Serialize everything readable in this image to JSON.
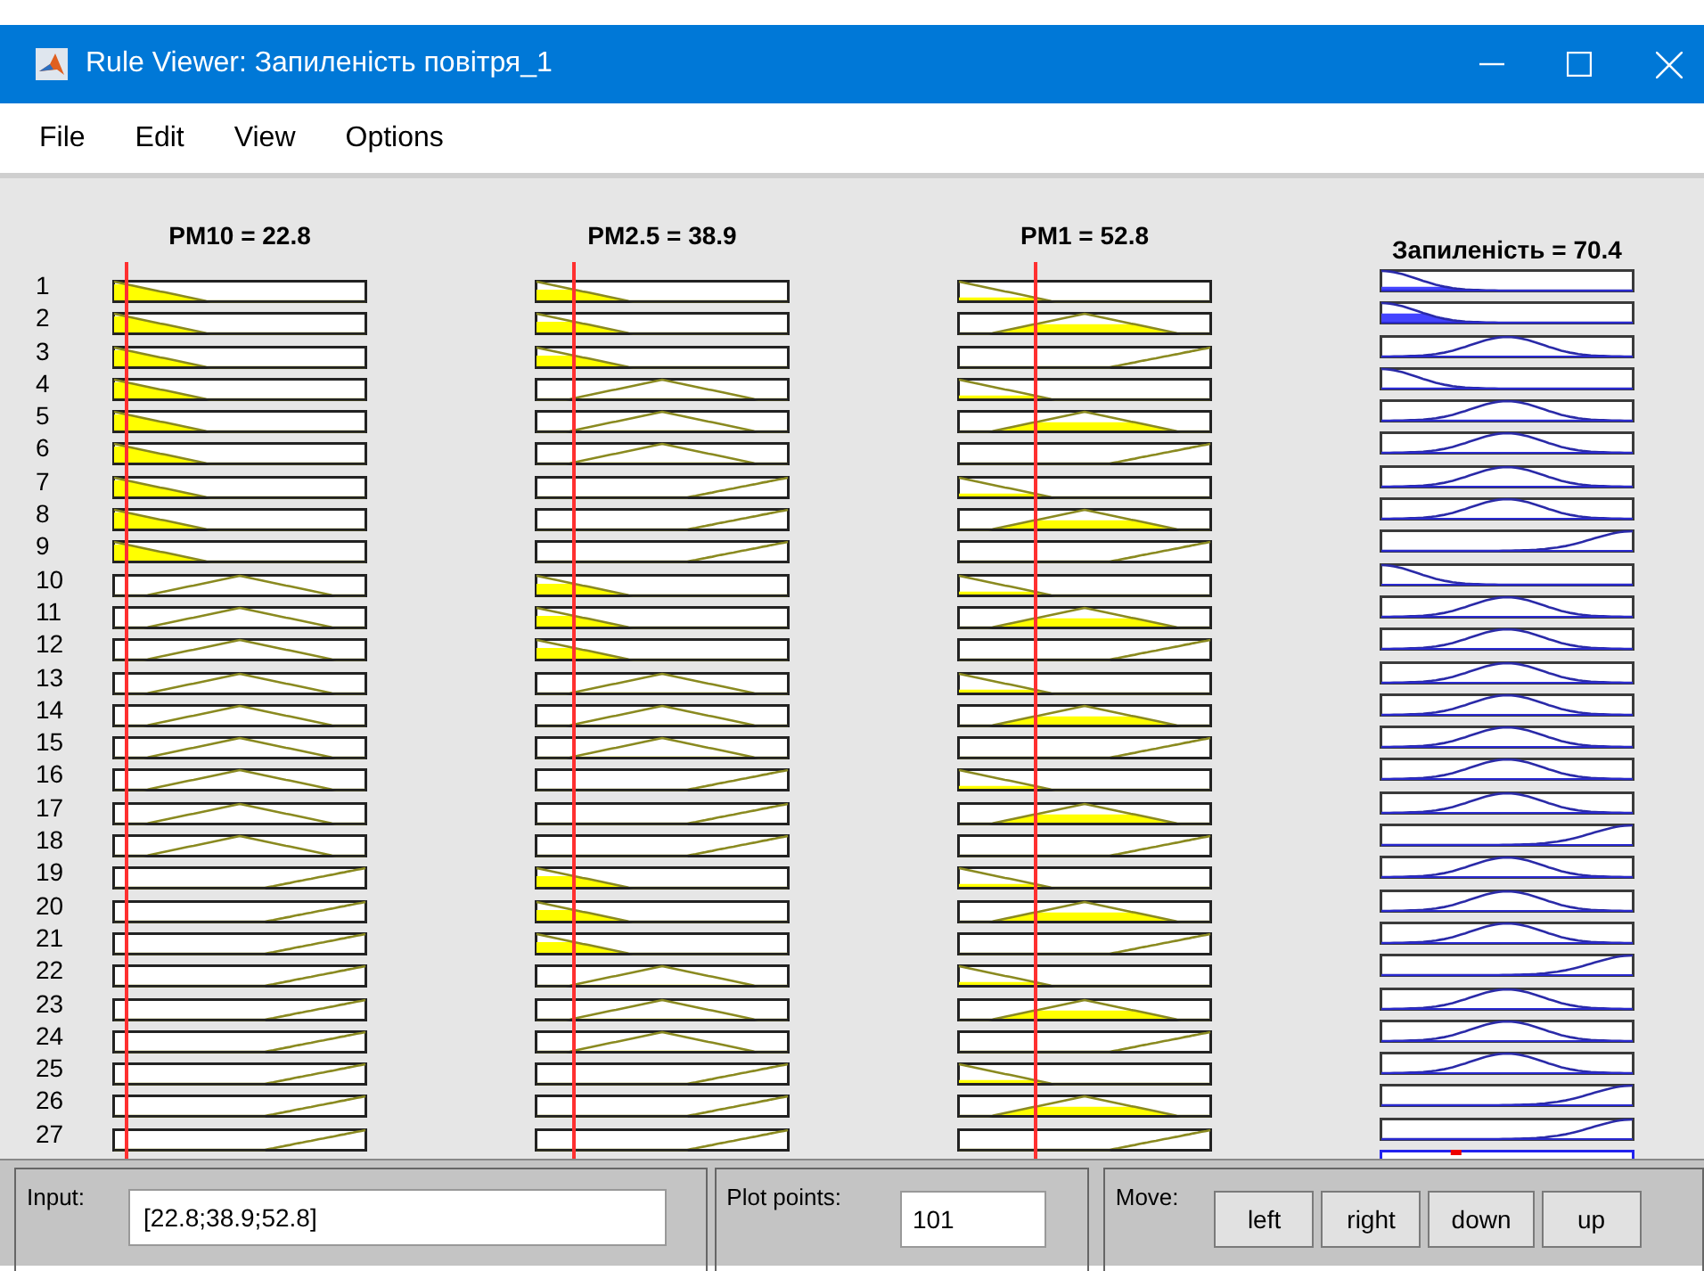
{
  "window": {
    "title": "Rule Viewer: Запиленість повітря_1"
  },
  "menu": [
    "File",
    "Edit",
    "View",
    "Options"
  ],
  "variables": [
    {
      "header": "PM10 = 22.8",
      "kind": "input"
    },
    {
      "header": "PM2.5 = 38.9",
      "kind": "input"
    },
    {
      "header": "PM1 = 52.8",
      "kind": "input"
    },
    {
      "header": "Запиленість = 70.4",
      "kind": "output"
    }
  ],
  "rules": [
    {
      "number": "1",
      "shapes": [
        {
          "kind": "low"
        },
        {
          "kind": "low"
        },
        {
          "kind": "low"
        },
        {
          "kind": "low"
        }
      ]
    },
    {
      "number": "2",
      "shapes": [
        {
          "kind": "low"
        },
        {
          "kind": "low"
        },
        {
          "kind": "mid"
        },
        {
          "kind": "low"
        }
      ]
    },
    {
      "number": "3",
      "shapes": [
        {
          "kind": "low"
        },
        {
          "kind": "low"
        },
        {
          "kind": "high"
        },
        {
          "kind": "mid"
        }
      ]
    },
    {
      "number": "4",
      "shapes": [
        {
          "kind": "low"
        },
        {
          "kind": "mid"
        },
        {
          "kind": "low"
        },
        {
          "kind": "low"
        }
      ]
    },
    {
      "number": "5",
      "shapes": [
        {
          "kind": "low"
        },
        {
          "kind": "mid"
        },
        {
          "kind": "mid"
        },
        {
          "kind": "mid"
        }
      ]
    },
    {
      "number": "6",
      "shapes": [
        {
          "kind": "low"
        },
        {
          "kind": "mid"
        },
        {
          "kind": "high"
        },
        {
          "kind": "mid"
        }
      ]
    },
    {
      "number": "7",
      "shapes": [
        {
          "kind": "low"
        },
        {
          "kind": "high"
        },
        {
          "kind": "low"
        },
        {
          "kind": "mid"
        }
      ]
    },
    {
      "number": "8",
      "shapes": [
        {
          "kind": "low"
        },
        {
          "kind": "high"
        },
        {
          "kind": "mid"
        },
        {
          "kind": "mid"
        }
      ]
    },
    {
      "number": "9",
      "shapes": [
        {
          "kind": "low"
        },
        {
          "kind": "high"
        },
        {
          "kind": "high"
        },
        {
          "kind": "high"
        }
      ]
    },
    {
      "number": "10",
      "shapes": [
        {
          "kind": "mid"
        },
        {
          "kind": "low"
        },
        {
          "kind": "low"
        },
        {
          "kind": "low"
        }
      ]
    },
    {
      "number": "11",
      "shapes": [
        {
          "kind": "mid"
        },
        {
          "kind": "low"
        },
        {
          "kind": "mid"
        },
        {
          "kind": "mid"
        }
      ]
    },
    {
      "number": "12",
      "shapes": [
        {
          "kind": "mid"
        },
        {
          "kind": "low"
        },
        {
          "kind": "high"
        },
        {
          "kind": "mid"
        }
      ]
    },
    {
      "number": "13",
      "shapes": [
        {
          "kind": "mid"
        },
        {
          "kind": "mid"
        },
        {
          "kind": "low"
        },
        {
          "kind": "mid"
        }
      ]
    },
    {
      "number": "14",
      "shapes": [
        {
          "kind": "mid"
        },
        {
          "kind": "mid"
        },
        {
          "kind": "mid"
        },
        {
          "kind": "mid"
        }
      ]
    },
    {
      "number": "15",
      "shapes": [
        {
          "kind": "mid"
        },
        {
          "kind": "mid"
        },
        {
          "kind": "high"
        },
        {
          "kind": "mid"
        }
      ]
    },
    {
      "number": "16",
      "shapes": [
        {
          "kind": "mid"
        },
        {
          "kind": "high"
        },
        {
          "kind": "low"
        },
        {
          "kind": "mid"
        }
      ]
    },
    {
      "number": "17",
      "shapes": [
        {
          "kind": "mid"
        },
        {
          "kind": "high"
        },
        {
          "kind": "mid"
        },
        {
          "kind": "mid"
        }
      ]
    },
    {
      "number": "18",
      "shapes": [
        {
          "kind": "mid"
        },
        {
          "kind": "high"
        },
        {
          "kind": "high"
        },
        {
          "kind": "high"
        }
      ]
    },
    {
      "number": "19",
      "shapes": [
        {
          "kind": "high"
        },
        {
          "kind": "low"
        },
        {
          "kind": "low"
        },
        {
          "kind": "mid"
        }
      ]
    },
    {
      "number": "20",
      "shapes": [
        {
          "kind": "high"
        },
        {
          "kind": "low"
        },
        {
          "kind": "mid"
        },
        {
          "kind": "mid"
        }
      ]
    },
    {
      "number": "21",
      "shapes": [
        {
          "kind": "high"
        },
        {
          "kind": "low"
        },
        {
          "kind": "high"
        },
        {
          "kind": "mid"
        }
      ]
    },
    {
      "number": "22",
      "shapes": [
        {
          "kind": "high"
        },
        {
          "kind": "mid"
        },
        {
          "kind": "low"
        },
        {
          "kind": "high"
        }
      ]
    },
    {
      "number": "23",
      "shapes": [
        {
          "kind": "high"
        },
        {
          "kind": "mid"
        },
        {
          "kind": "mid"
        },
        {
          "kind": "mid"
        }
      ]
    },
    {
      "number": "24",
      "shapes": [
        {
          "kind": "high"
        },
        {
          "kind": "mid"
        },
        {
          "kind": "high"
        },
        {
          "kind": "mid"
        }
      ]
    },
    {
      "number": "25",
      "shapes": [
        {
          "kind": "high"
        },
        {
          "kind": "high"
        },
        {
          "kind": "low"
        },
        {
          "kind": "mid"
        }
      ]
    },
    {
      "number": "26",
      "shapes": [
        {
          "kind": "high"
        },
        {
          "kind": "high"
        },
        {
          "kind": "mid"
        },
        {
          "kind": "high"
        }
      ]
    },
    {
      "number": "27",
      "shapes": [
        {
          "kind": "high"
        },
        {
          "kind": "high"
        },
        {
          "kind": "high"
        },
        {
          "kind": "high"
        }
      ]
    }
  ],
  "input": {
    "label": "Input:",
    "value": "[22.8;38.9;52.8]"
  },
  "plot_points": {
    "label": "Plot points:",
    "value": "101"
  },
  "move": {
    "label": "Move:",
    "buttons": [
      "left",
      "right",
      "down",
      "up"
    ]
  }
}
